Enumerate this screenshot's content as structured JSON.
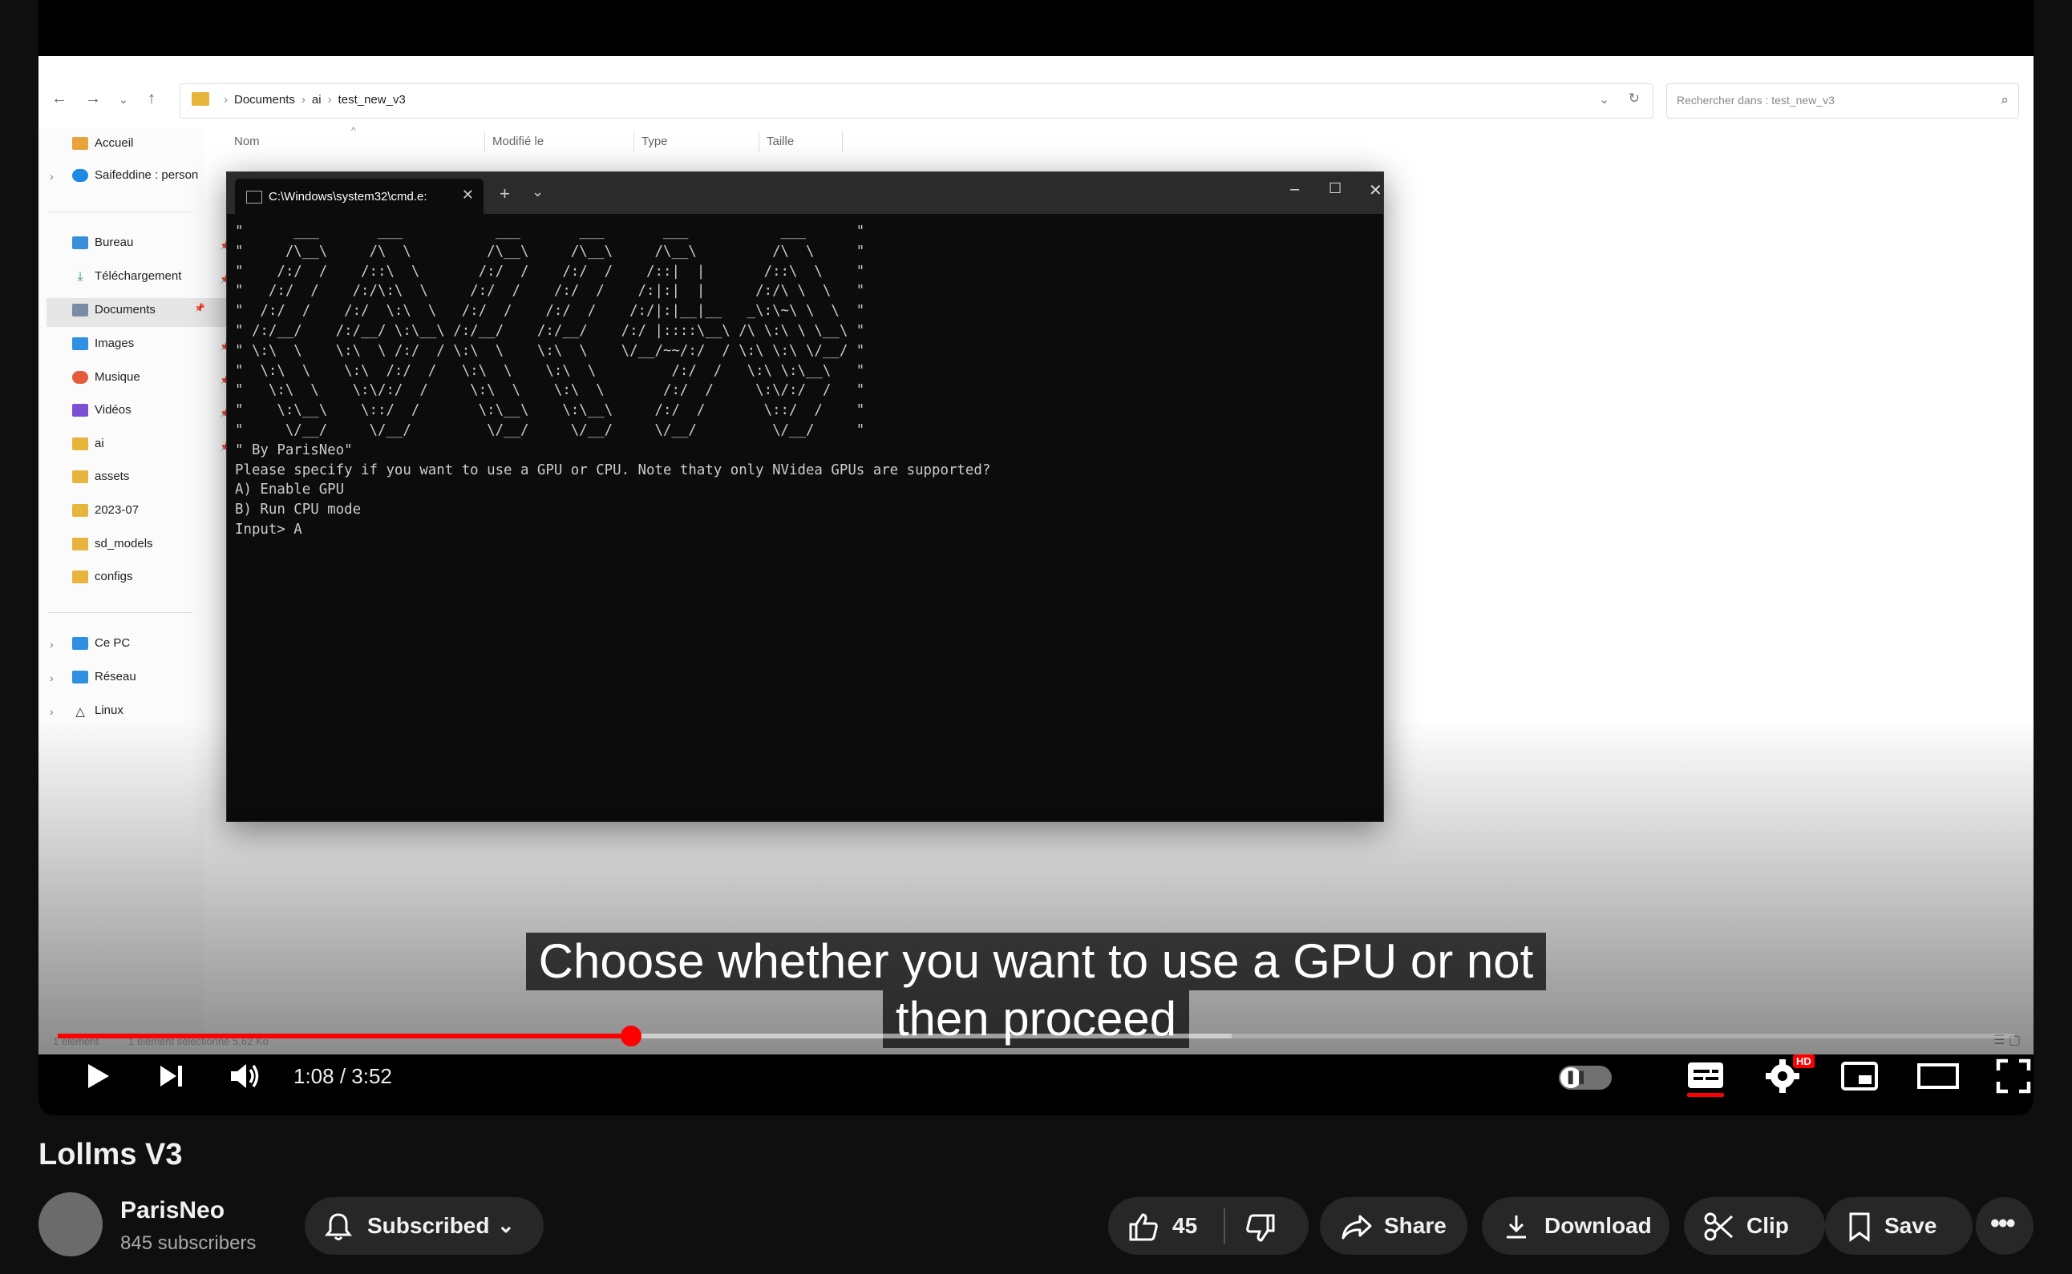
{
  "explorer": {
    "breadcrumb": [
      "Documents",
      "ai",
      "test_new_v3"
    ],
    "search_placeholder": "Rechercher dans : test_new_v3",
    "columns": [
      "Nom",
      "Modifié le",
      "Type",
      "Taille"
    ],
    "sidebar": [
      {
        "label": "Accueil",
        "icon": "home-icon",
        "color": "#e8a33b"
      },
      {
        "label": "Saifeddine : person",
        "icon": "cloud-icon",
        "color": "#1e88e5"
      },
      {
        "label": "Bureau",
        "icon": "desktop-icon",
        "color": "#3b8fd9"
      },
      {
        "label": "Téléchargement",
        "icon": "download-icon",
        "color": "#2b9a5f"
      },
      {
        "label": "Documents",
        "icon": "documents-icon",
        "color": "#7a8ba6"
      },
      {
        "label": "Images",
        "icon": "images-icon",
        "color": "#2f8fe0"
      },
      {
        "label": "Musique",
        "icon": "music-icon",
        "color": "#e55a3a"
      },
      {
        "label": "Vidéos",
        "icon": "videos-icon",
        "color": "#7b4fd6"
      },
      {
        "label": "ai",
        "icon": "folder-icon",
        "color": "#e7b53c"
      },
      {
        "label": "assets",
        "icon": "folder-icon",
        "color": "#e7b53c"
      },
      {
        "label": "2023-07",
        "icon": "folder-icon",
        "color": "#e7b53c"
      },
      {
        "label": "sd_models",
        "icon": "folder-icon",
        "color": "#e7b53c"
      },
      {
        "label": "configs",
        "icon": "folder-icon",
        "color": "#e7b53c"
      },
      {
        "label": "Ce PC",
        "icon": "pc-icon",
        "color": "#2f8fe0"
      },
      {
        "label": "Réseau",
        "icon": "network-icon",
        "color": "#2f8fe0"
      },
      {
        "label": "Linux",
        "icon": "linux-icon",
        "color": "#222222"
      }
    ],
    "status_left": "1 élément",
    "status_right": "1 élément sélectionné  5,62 Ko"
  },
  "terminal": {
    "tab_title": "C:\\Windows\\system32\\cmd.e:",
    "lines": [
      "\"      ___       ___           ___       ___       ___           ___      \"",
      "\"     /\\__\\     /\\  \\         /\\__\\     /\\__\\     /\\__\\         /\\  \\     \"",
      "\"    /:/  /    /::\\  \\       /:/  /    /:/  /    /::|  |       /::\\  \\    \"",
      "\"   /:/  /    /:/\\:\\  \\     /:/  /    /:/  /    /:|:|  |      /:/\\ \\  \\   \"",
      "\"  /:/  /    /:/  \\:\\  \\   /:/  /    /:/  /    /:/|:|__|__   _\\:\\~\\ \\  \\  \"",
      "\" /:/__/    /:/__/ \\:\\__\\ /:/__/    /:/__/    /:/ |::::\\__\\ /\\ \\:\\ \\ \\__\\ \"",
      "\" \\:\\  \\    \\:\\  \\ /:/  / \\:\\  \\    \\:\\  \\    \\/__/~~/:/  / \\:\\ \\:\\ \\/__/ \"",
      "\"  \\:\\  \\    \\:\\  /:/  /   \\:\\  \\    \\:\\  \\         /:/  /   \\:\\ \\:\\__\\   \"",
      "\"   \\:\\  \\    \\:\\/:/  /     \\:\\  \\    \\:\\  \\       /:/  /     \\:\\/:/  /   \"",
      "\"    \\:\\__\\    \\::/  /       \\:\\__\\    \\:\\__\\     /:/  /       \\::/  /    \"",
      "\"     \\/__/     \\/__/         \\/__/     \\/__/     \\/__/         \\/__/     \"",
      "\" By ParisNeo\"",
      "Please specify if you want to use a GPU or CPU. Note thaty only NVidea GPUs are supported?",
      "A) Enable GPU",
      "B) Run CPU mode",
      "Input> A"
    ]
  },
  "subtitles": [
    "Choose whether you want to use a GPU or not",
    "then proceed"
  ],
  "player": {
    "current_time": "1:08",
    "duration": "3:52",
    "time_display": "1:08 / 3:52",
    "progress_fraction": 0.2931,
    "buffered_fraction": 0.6,
    "hd_badge": "HD",
    "accent_color": "#ff0000"
  },
  "video": {
    "title": "Lollms V3",
    "channel": "ParisNeo",
    "subscribers": "845 subscribers",
    "subscribe_label": "Subscribed",
    "likes": "45",
    "share_label": "Share",
    "download_label": "Download",
    "clip_label": "Clip",
    "save_label": "Save"
  }
}
